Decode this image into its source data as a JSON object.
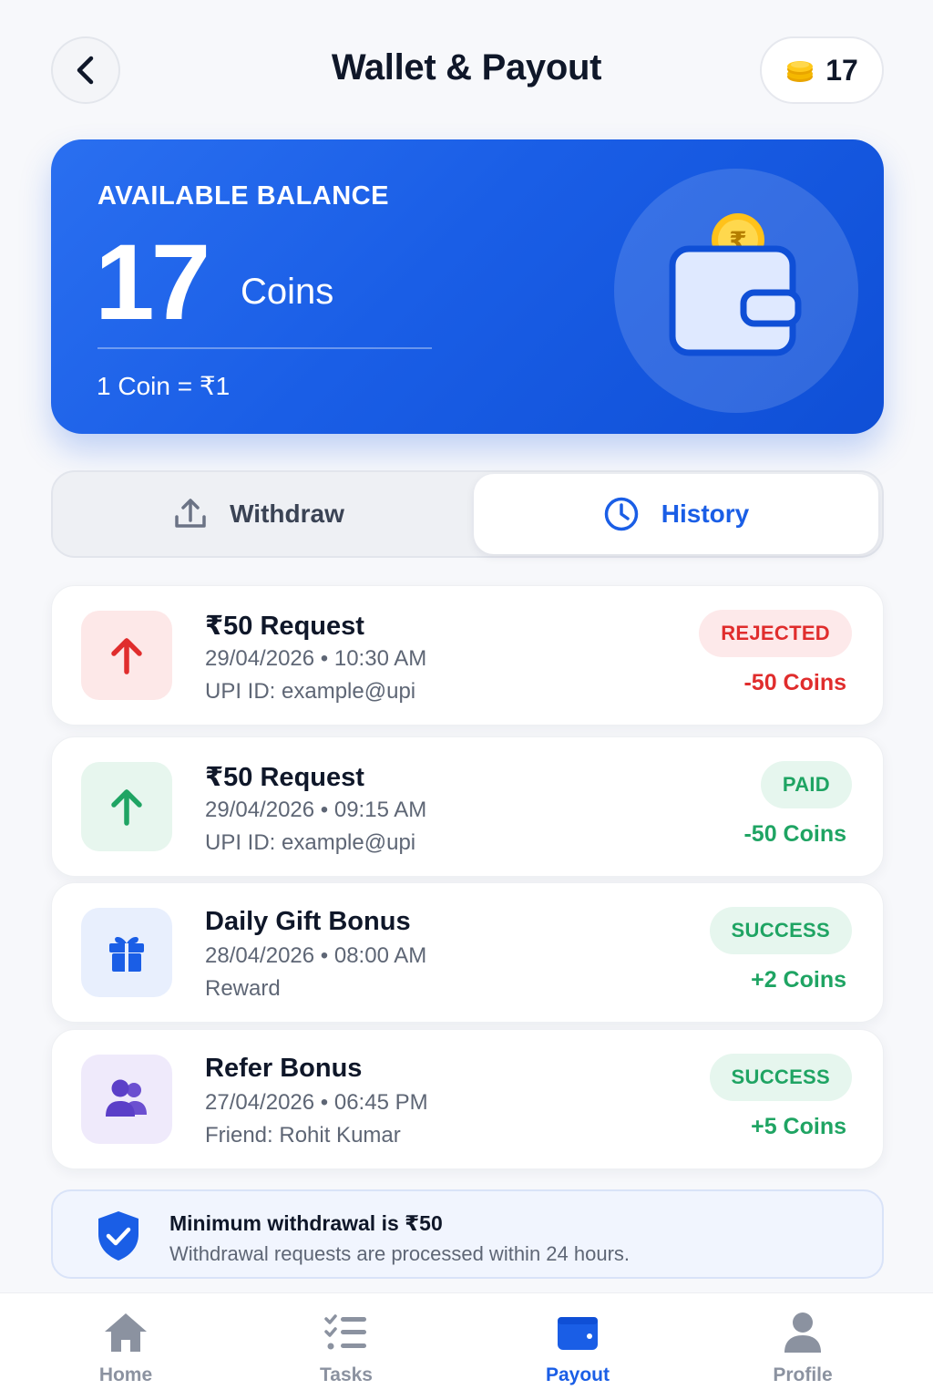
{
  "header": {
    "title": "Wallet & Payout",
    "coin_count": "17"
  },
  "balance": {
    "label": "AVAILABLE BALANCE",
    "value": "17",
    "unit": "Coins",
    "rate": "1 Coin = ₹1"
  },
  "tabs": {
    "withdraw": "Withdraw",
    "history": "History",
    "active": "History"
  },
  "transactions": [
    {
      "title": "₹50 Request",
      "date": "29/04/2026 • 10:30 AM",
      "sub": "UPI ID: example@upi",
      "status": "REJECTED",
      "amount": "-50 Coins",
      "icon": "arrow-up-icon",
      "status_color": "#e02d2d"
    },
    {
      "title": "₹50 Request",
      "date": "29/04/2026 • 09:15 AM",
      "sub": "UPI ID: example@upi",
      "status": "PAID",
      "amount": "-50 Coins",
      "icon": "arrow-up-icon",
      "status_color": "#1fa463"
    },
    {
      "title": "Daily Gift Bonus",
      "date": "28/04/2026 • 08:00 AM",
      "sub": "Reward",
      "status": "SUCCESS",
      "amount": "+2 Coins",
      "icon": "gift-icon",
      "status_color": "#1fa463"
    },
    {
      "title": "Refer Bonus",
      "date": "27/04/2026 • 06:45 PM",
      "sub": "Friend: Rohit Kumar",
      "status": "SUCCESS",
      "amount": "+5 Coins",
      "icon": "users-icon",
      "status_color": "#1fa463"
    }
  ],
  "info": {
    "title": "Minimum withdrawal is ₹50",
    "text": "Withdrawal requests are processed within 24 hours."
  },
  "nav": {
    "items": [
      {
        "label": "Home",
        "icon": "home-icon"
      },
      {
        "label": "Tasks",
        "icon": "tasks-icon"
      },
      {
        "label": "Payout",
        "icon": "wallet-icon"
      },
      {
        "label": "Profile",
        "icon": "profile-icon"
      }
    ],
    "active": "Payout"
  },
  "colors": {
    "primary": "#1a5ee6",
    "danger": "#e02d2d",
    "success": "#1fa463",
    "coin": "#f5b800"
  }
}
